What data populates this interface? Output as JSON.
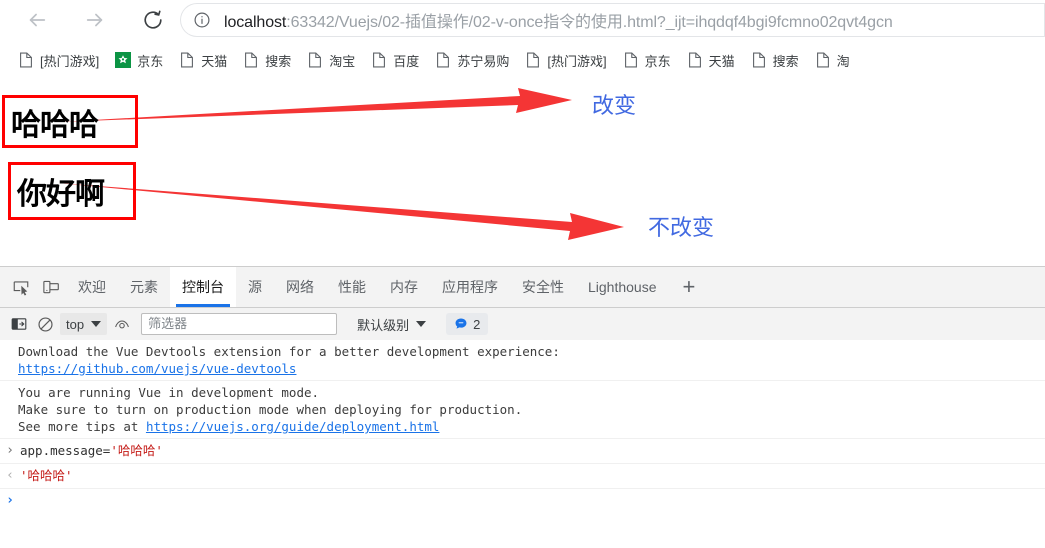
{
  "browser": {
    "nav": {
      "back_label": "Back",
      "forward_label": "Forward",
      "reload_label": "Reload"
    },
    "omnibox": {
      "info_icon": "info-circle-icon",
      "host": "localhost",
      "path": ":63342/Vuejs/02-插值操作/02-v-once指令的使用.html?_ijt=ihqdqf4bgi9fcmno02qvt4gcn",
      "full_url": "localhost:63342/Vuejs/02-插值操作/02-v-once指令的使用.html?_ijt=ihqdqf4bgi9fcmno02qvt4gcn"
    },
    "bookmarks": [
      {
        "label": "[热门游戏]",
        "icon": "page-icon"
      },
      {
        "label": "京东",
        "icon": "jd-icon"
      },
      {
        "label": "天猫",
        "icon": "page-icon"
      },
      {
        "label": "搜索",
        "icon": "page-icon"
      },
      {
        "label": "淘宝",
        "icon": "page-icon"
      },
      {
        "label": "百度",
        "icon": "page-icon"
      },
      {
        "label": "苏宁易购",
        "icon": "page-icon"
      },
      {
        "label": "[热门游戏]",
        "icon": "page-icon"
      },
      {
        "label": "京东",
        "icon": "page-icon"
      },
      {
        "label": "天猫",
        "icon": "page-icon"
      },
      {
        "label": "搜索",
        "icon": "page-icon"
      },
      {
        "label": "淘",
        "icon": "page-icon"
      }
    ]
  },
  "page": {
    "boxes": [
      {
        "text": "哈哈哈"
      },
      {
        "text": "你好啊"
      }
    ],
    "annotations": [
      {
        "text": "改变",
        "color": "#4169e1"
      },
      {
        "text": "不改变",
        "color": "#4169e1"
      }
    ],
    "arrow_color": "#f43535",
    "box_border_color": "#ff0000"
  },
  "devtools": {
    "icons": {
      "inspect": "inspect-element-icon",
      "device": "device-toolbar-icon"
    },
    "tabs": [
      {
        "label": "欢迎",
        "active": false
      },
      {
        "label": "元素",
        "active": false
      },
      {
        "label": "控制台",
        "active": true
      },
      {
        "label": "源",
        "active": false
      },
      {
        "label": "网络",
        "active": false
      },
      {
        "label": "性能",
        "active": false
      },
      {
        "label": "内存",
        "active": false
      },
      {
        "label": "应用程序",
        "active": false
      },
      {
        "label": "安全性",
        "active": false
      },
      {
        "label": "Lighthouse",
        "active": false
      }
    ],
    "more_tabs_label": "+",
    "active_tab_underline_color": "#1a73e8",
    "toolbar": {
      "sidebar_icon": "console-sidebar-icon",
      "clear_icon": "clear-console-icon",
      "context_value": "top",
      "eye_icon": "live-expression-eye-icon",
      "filter_placeholder": "筛选器",
      "level_label": "默认级别",
      "message_icon": "info-message-icon",
      "message_count": "2"
    },
    "console": {
      "messages": [
        {
          "type": "info",
          "lines": [
            {
              "text": "Download the Vue Devtools extension for a better development experience:",
              "link": null
            },
            {
              "text": "",
              "link": "https://github.com/vuejs/vue-devtools"
            }
          ]
        },
        {
          "type": "info",
          "lines": [
            {
              "text": "You are running Vue in development mode.",
              "link": null
            },
            {
              "text": "Make sure to turn on production mode when deploying for production.",
              "link": null
            },
            {
              "text": "See more tips at ",
              "link": "https://vuejs.org/guide/deployment.html"
            }
          ]
        }
      ],
      "input_entry": {
        "gutter": "›",
        "code_prefix": "app.message=",
        "code_value": "'哈哈哈'"
      },
      "output_entry": {
        "gutter": "‹",
        "value": "'哈哈哈'"
      },
      "prompt": {
        "gutter": "›",
        "value": ""
      }
    }
  }
}
